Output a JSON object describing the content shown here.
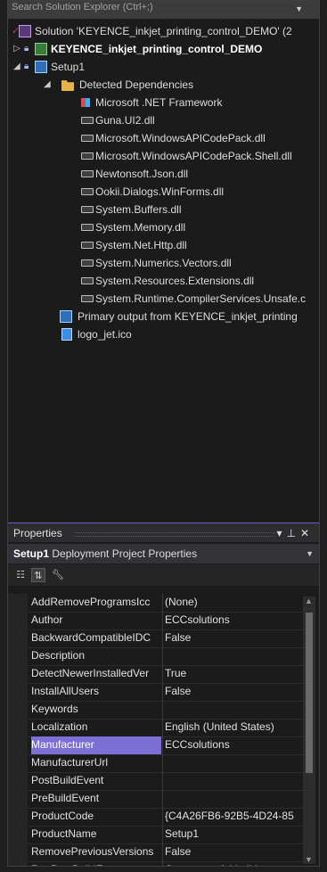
{
  "search": {
    "placeholder": "Search Solution Explorer (Ctrl+;)"
  },
  "tree": {
    "solution": "Solution 'KEYENCE_inkjet_printing_control_DEMO' (2",
    "project": "KEYENCE_inkjet_printing_control_DEMO",
    "setup": "Setup1",
    "detected": "Detected Dependencies",
    "deps": [
      "Microsoft .NET Framework",
      "Guna.UI2.dll",
      "Microsoft.WindowsAPICodePack.dll",
      "Microsoft.WindowsAPICodePack.Shell.dll",
      "Newtonsoft.Json.dll",
      "Ookii.Dialogs.WinForms.dll",
      "System.Buffers.dll",
      "System.Memory.dll",
      "System.Net.Http.dll",
      "System.Numerics.Vectors.dll",
      "System.Resources.Extensions.dll",
      "System.Runtime.CompilerServices.Unsafe.c"
    ],
    "primary_output": "Primary output from KEYENCE_inkjet_printing",
    "logo": "logo_jet.ico"
  },
  "properties": {
    "title": "Properties",
    "object_name": "Setup1",
    "object_type": "Deployment Project Properties",
    "rows": [
      {
        "name": "AddRemoveProgramsIcc",
        "value": "(None)"
      },
      {
        "name": "Author",
        "value": "ECCsolutions"
      },
      {
        "name": "BackwardCompatibleIDC",
        "value": "False"
      },
      {
        "name": "Description",
        "value": ""
      },
      {
        "name": "DetectNewerInstalledVer",
        "value": "True"
      },
      {
        "name": "InstallAllUsers",
        "value": "False"
      },
      {
        "name": "Keywords",
        "value": ""
      },
      {
        "name": "Localization",
        "value": "English (United States)"
      },
      {
        "name": "Manufacturer",
        "value": "ECCsolutions"
      },
      {
        "name": "ManufacturerUrl",
        "value": ""
      },
      {
        "name": "PostBuildEvent",
        "value": ""
      },
      {
        "name": "PreBuildEvent",
        "value": ""
      },
      {
        "name": "ProductCode",
        "value": "{C4A26FB6-92B5-4D24-85"
      },
      {
        "name": "ProductName",
        "value": "Setup1"
      },
      {
        "name": "RemovePreviousVersions",
        "value": "False"
      },
      {
        "name": "RunPostBuildEvent",
        "value": "On successful build"
      }
    ],
    "selected_index": 8
  },
  "colors": {
    "selection": "#7b6fd6",
    "accent": "#6b60c6"
  }
}
